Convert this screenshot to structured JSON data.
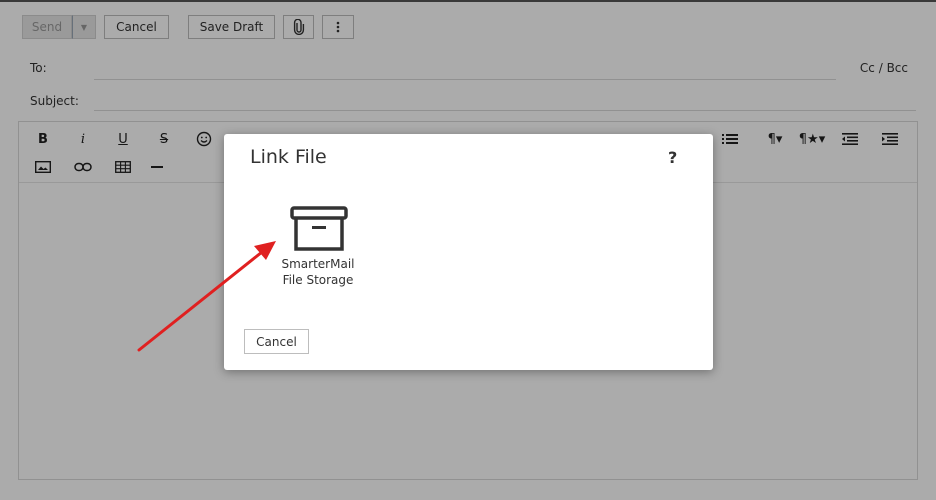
{
  "toolbar": {
    "send_label": "Send",
    "cancel_label": "Cancel",
    "save_draft_label": "Save Draft",
    "attach_icon": "paperclip-icon",
    "more_icon": "vertical-dots-icon"
  },
  "compose": {
    "to_label": "To:",
    "subject_label": "Subject:",
    "cc_bcc_label": "Cc / Bcc"
  },
  "editor_toolbar": {
    "bold": "B",
    "italic": "i",
    "underline": "U",
    "strike": "S"
  },
  "modal": {
    "title": "Link File",
    "help": "?",
    "option_label_line1": "SmarterMail",
    "option_label_line2": "File Storage",
    "cancel_label": "Cancel"
  },
  "colors": {
    "overlay": "#000000",
    "arrow": "#e02020",
    "disabled_text": "#9a9a9a"
  }
}
